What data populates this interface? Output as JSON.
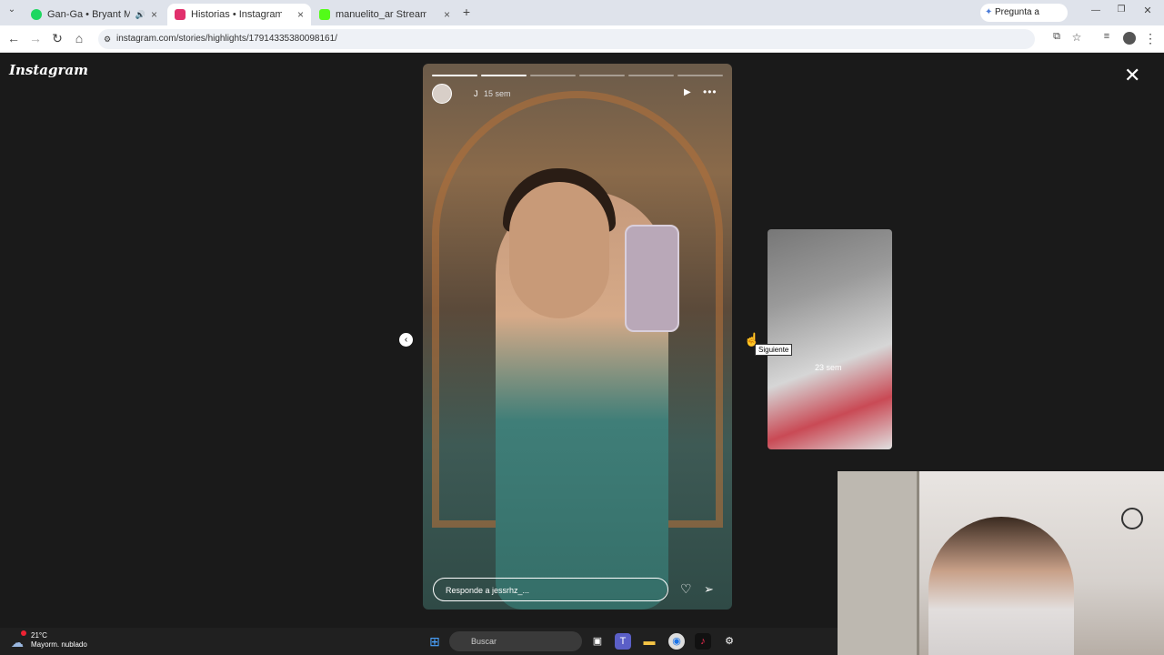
{
  "browser": {
    "tabs": [
      {
        "label": "Gan-Ga • Bryant Myers, Anu",
        "favicon_color": "#1ed760"
      },
      {
        "label": "Historias • Instagram",
        "favicon_color": "#e1306c"
      },
      {
        "label": "manuelito_ar Stream - Watch Li",
        "favicon_color": "#53fc18"
      }
    ],
    "new_tab": "+",
    "gemini": "Pregunta a Gemini",
    "url": "instagram.com/stories/highlights/17914335380098161/"
  },
  "instagram": {
    "logo": "Instagram",
    "close": "✕",
    "story": {
      "username": "J",
      "time": "15 sem",
      "reply_placeholder": "Responde a jessrhz_...",
      "progress_segments": [
        true,
        true,
        false,
        false,
        false,
        false
      ]
    },
    "next_story": {
      "time": "23 sem"
    },
    "tooltip": "Siguiente"
  },
  "taskbar": {
    "temperature": "21°C",
    "weather_desc": "Mayorm. nublado",
    "search_label": "Buscar"
  }
}
